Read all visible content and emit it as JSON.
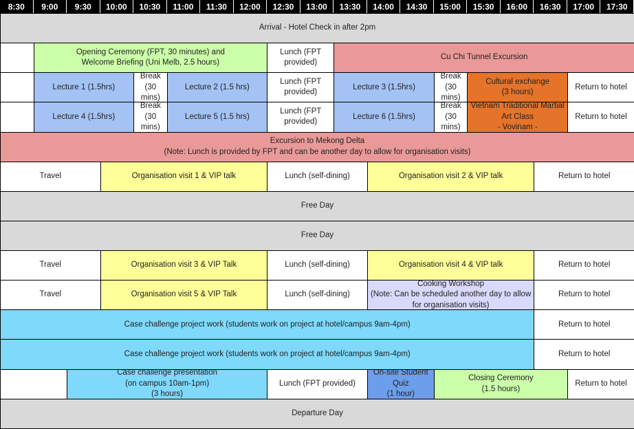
{
  "times": [
    "8:30",
    "9:00",
    "9:30",
    "10:00",
    "10:30",
    "11:00",
    "11:30",
    "12:00",
    "12:30",
    "13:00",
    "13:30",
    "14:00",
    "14:30",
    "15:00",
    "15:30",
    "16:00",
    "16:30",
    "17:00",
    "17:30"
  ],
  "colors": {
    "grey": "#d9d9d9",
    "white": "#ffffff",
    "green": "#ccffaa",
    "red": "#ea9999",
    "blue": "#a4c2f4",
    "orange": "#e6732a",
    "yellow": "#ffff99",
    "lavender": "#d9d9fc",
    "cyan": "#7ed9fb",
    "quiz_blue": "#6d9eeb"
  },
  "rows": [
    {
      "cells": [
        {
          "start": 1,
          "end": 20,
          "color": "grey",
          "text": "Arrival - Hotel Check in after 2pm"
        }
      ]
    },
    {
      "cells": [
        {
          "start": 1,
          "end": 2,
          "color": "white",
          "text": ""
        },
        {
          "start": 2,
          "end": 9,
          "color": "green",
          "text": "Opening Ceremony (FPT, 30 minutes) and\nWelcome Briefing (Uni Melb, 2.5 hours)"
        },
        {
          "start": 9,
          "end": 11,
          "color": "white",
          "text": "Lunch (FPT\nprovided)"
        },
        {
          "start": 11,
          "end": 20,
          "color": "red",
          "text": "Cu Chi Tunnel Excursion"
        }
      ]
    },
    {
      "cells": [
        {
          "start": 1,
          "end": 2,
          "color": "white",
          "text": ""
        },
        {
          "start": 2,
          "end": 5,
          "color": "blue",
          "text": "Lecture 1 (1.5hrs)"
        },
        {
          "start": 5,
          "end": 6,
          "color": "white",
          "text": "Break\n(30\nmins)"
        },
        {
          "start": 6,
          "end": 9,
          "color": "blue",
          "text": "Lecture 2 (1.5 hrs)"
        },
        {
          "start": 9,
          "end": 11,
          "color": "white",
          "text": "Lunch (FPT\nprovided)"
        },
        {
          "start": 11,
          "end": 14,
          "color": "blue",
          "text": "Lecture 3 (1.5hrs)"
        },
        {
          "start": 14,
          "end": 15,
          "color": "white",
          "text": "Break\n(30\nmins)"
        },
        {
          "start": 15,
          "end": 18,
          "color": "orange",
          "text": "Cultural exchange\n(3 hours)"
        },
        {
          "start": 18,
          "end": 20,
          "color": "white",
          "text": "Return to hotel"
        }
      ]
    },
    {
      "cells": [
        {
          "start": 1,
          "end": 2,
          "color": "white",
          "text": ""
        },
        {
          "start": 2,
          "end": 5,
          "color": "blue",
          "text": "Lecture 4 (1.5hrs)"
        },
        {
          "start": 5,
          "end": 6,
          "color": "white",
          "text": "Break\n(30\nmins)"
        },
        {
          "start": 6,
          "end": 9,
          "color": "blue",
          "text": "Lecture 5 (1.5 hrs)"
        },
        {
          "start": 9,
          "end": 11,
          "color": "white",
          "text": "Lunch (FPT\nprovided)"
        },
        {
          "start": 11,
          "end": 14,
          "color": "blue",
          "text": "Lecture 6 (1.5hrs)"
        },
        {
          "start": 14,
          "end": 15,
          "color": "white",
          "text": "Break\n(30\nmins)"
        },
        {
          "start": 15,
          "end": 18,
          "color": "orange",
          "text": "Vietnam Traditional Martial\nArt Class\n- Vovinam -"
        },
        {
          "start": 18,
          "end": 20,
          "color": "white",
          "text": "Return to hotel"
        }
      ]
    },
    {
      "cells": [
        {
          "start": 1,
          "end": 20,
          "color": "red",
          "text": "Excursion to Mekong Delta\n(Note: Lunch is provided by FPT and can be another day to allow for organisation visits)"
        }
      ]
    },
    {
      "cells": [
        {
          "start": 1,
          "end": 4,
          "color": "white",
          "text": "Travel"
        },
        {
          "start": 4,
          "end": 9,
          "color": "yellow",
          "text": "Organisation visit 1 & VIP talk"
        },
        {
          "start": 9,
          "end": 12,
          "color": "white",
          "text": "Lunch (self-dining)"
        },
        {
          "start": 12,
          "end": 17,
          "color": "yellow",
          "text": "Organisation visit 2 & VIP talk"
        },
        {
          "start": 17,
          "end": 20,
          "color": "white",
          "text": "Return to hotel"
        }
      ]
    },
    {
      "cells": [
        {
          "start": 1,
          "end": 20,
          "color": "grey",
          "text": "Free Day"
        }
      ]
    },
    {
      "cells": [
        {
          "start": 1,
          "end": 20,
          "color": "grey",
          "text": "Free Day"
        }
      ]
    },
    {
      "cells": [
        {
          "start": 1,
          "end": 4,
          "color": "white",
          "text": "Travel"
        },
        {
          "start": 4,
          "end": 9,
          "color": "yellow",
          "text": "Organisation visit 3 & VIP Talk"
        },
        {
          "start": 9,
          "end": 12,
          "color": "white",
          "text": "Lunch (self-dining)"
        },
        {
          "start": 12,
          "end": 17,
          "color": "yellow",
          "text": "Organisation visit 4 & VIP talk"
        },
        {
          "start": 17,
          "end": 20,
          "color": "white",
          "text": "Return to hotel"
        }
      ]
    },
    {
      "cells": [
        {
          "start": 1,
          "end": 4,
          "color": "white",
          "text": "Travel"
        },
        {
          "start": 4,
          "end": 9,
          "color": "yellow",
          "text": "Organisation visit 5 & VIP Talk"
        },
        {
          "start": 9,
          "end": 12,
          "color": "white",
          "text": "Lunch (self-dining)"
        },
        {
          "start": 12,
          "end": 17,
          "color": "lavender",
          "text": "Cooking Workshop\n(Note: Can be scheduled another day to allow\nfor organisation visits)"
        },
        {
          "start": 17,
          "end": 20,
          "color": "white",
          "text": "Return to hotel"
        }
      ]
    },
    {
      "cells": [
        {
          "start": 1,
          "end": 17,
          "color": "cyan",
          "text": "Case challenge project work (students work on project at hotel/campus 9am-4pm)"
        },
        {
          "start": 17,
          "end": 20,
          "color": "white",
          "text": "Return to hotel"
        }
      ]
    },
    {
      "cells": [
        {
          "start": 1,
          "end": 17,
          "color": "cyan",
          "text": "Case challenge project work (students work on project at hotel/campus 9am-4pm)"
        },
        {
          "start": 17,
          "end": 20,
          "color": "white",
          "text": "Return to hotel"
        }
      ]
    },
    {
      "cells": [
        {
          "start": 1,
          "end": 3,
          "color": "white",
          "text": ""
        },
        {
          "start": 3,
          "end": 9,
          "color": "cyan",
          "text": "Case challenge presentation\n(on campus 10am-1pm)\n(3 hours)"
        },
        {
          "start": 9,
          "end": 12,
          "color": "white",
          "text": "Lunch (FPT provided)"
        },
        {
          "start": 12,
          "end": 14,
          "color": "quiz_blue",
          "text": "On-site Student\nQuiz\n(1 hour)"
        },
        {
          "start": 14,
          "end": 18,
          "color": "green",
          "text": "Closing Ceremony\n(1.5 hours)"
        },
        {
          "start": 18,
          "end": 20,
          "color": "white",
          "text": "Return to hotel"
        }
      ]
    },
    {
      "cells": [
        {
          "start": 1,
          "end": 20,
          "color": "grey",
          "text": "Departure Day"
        }
      ]
    }
  ]
}
